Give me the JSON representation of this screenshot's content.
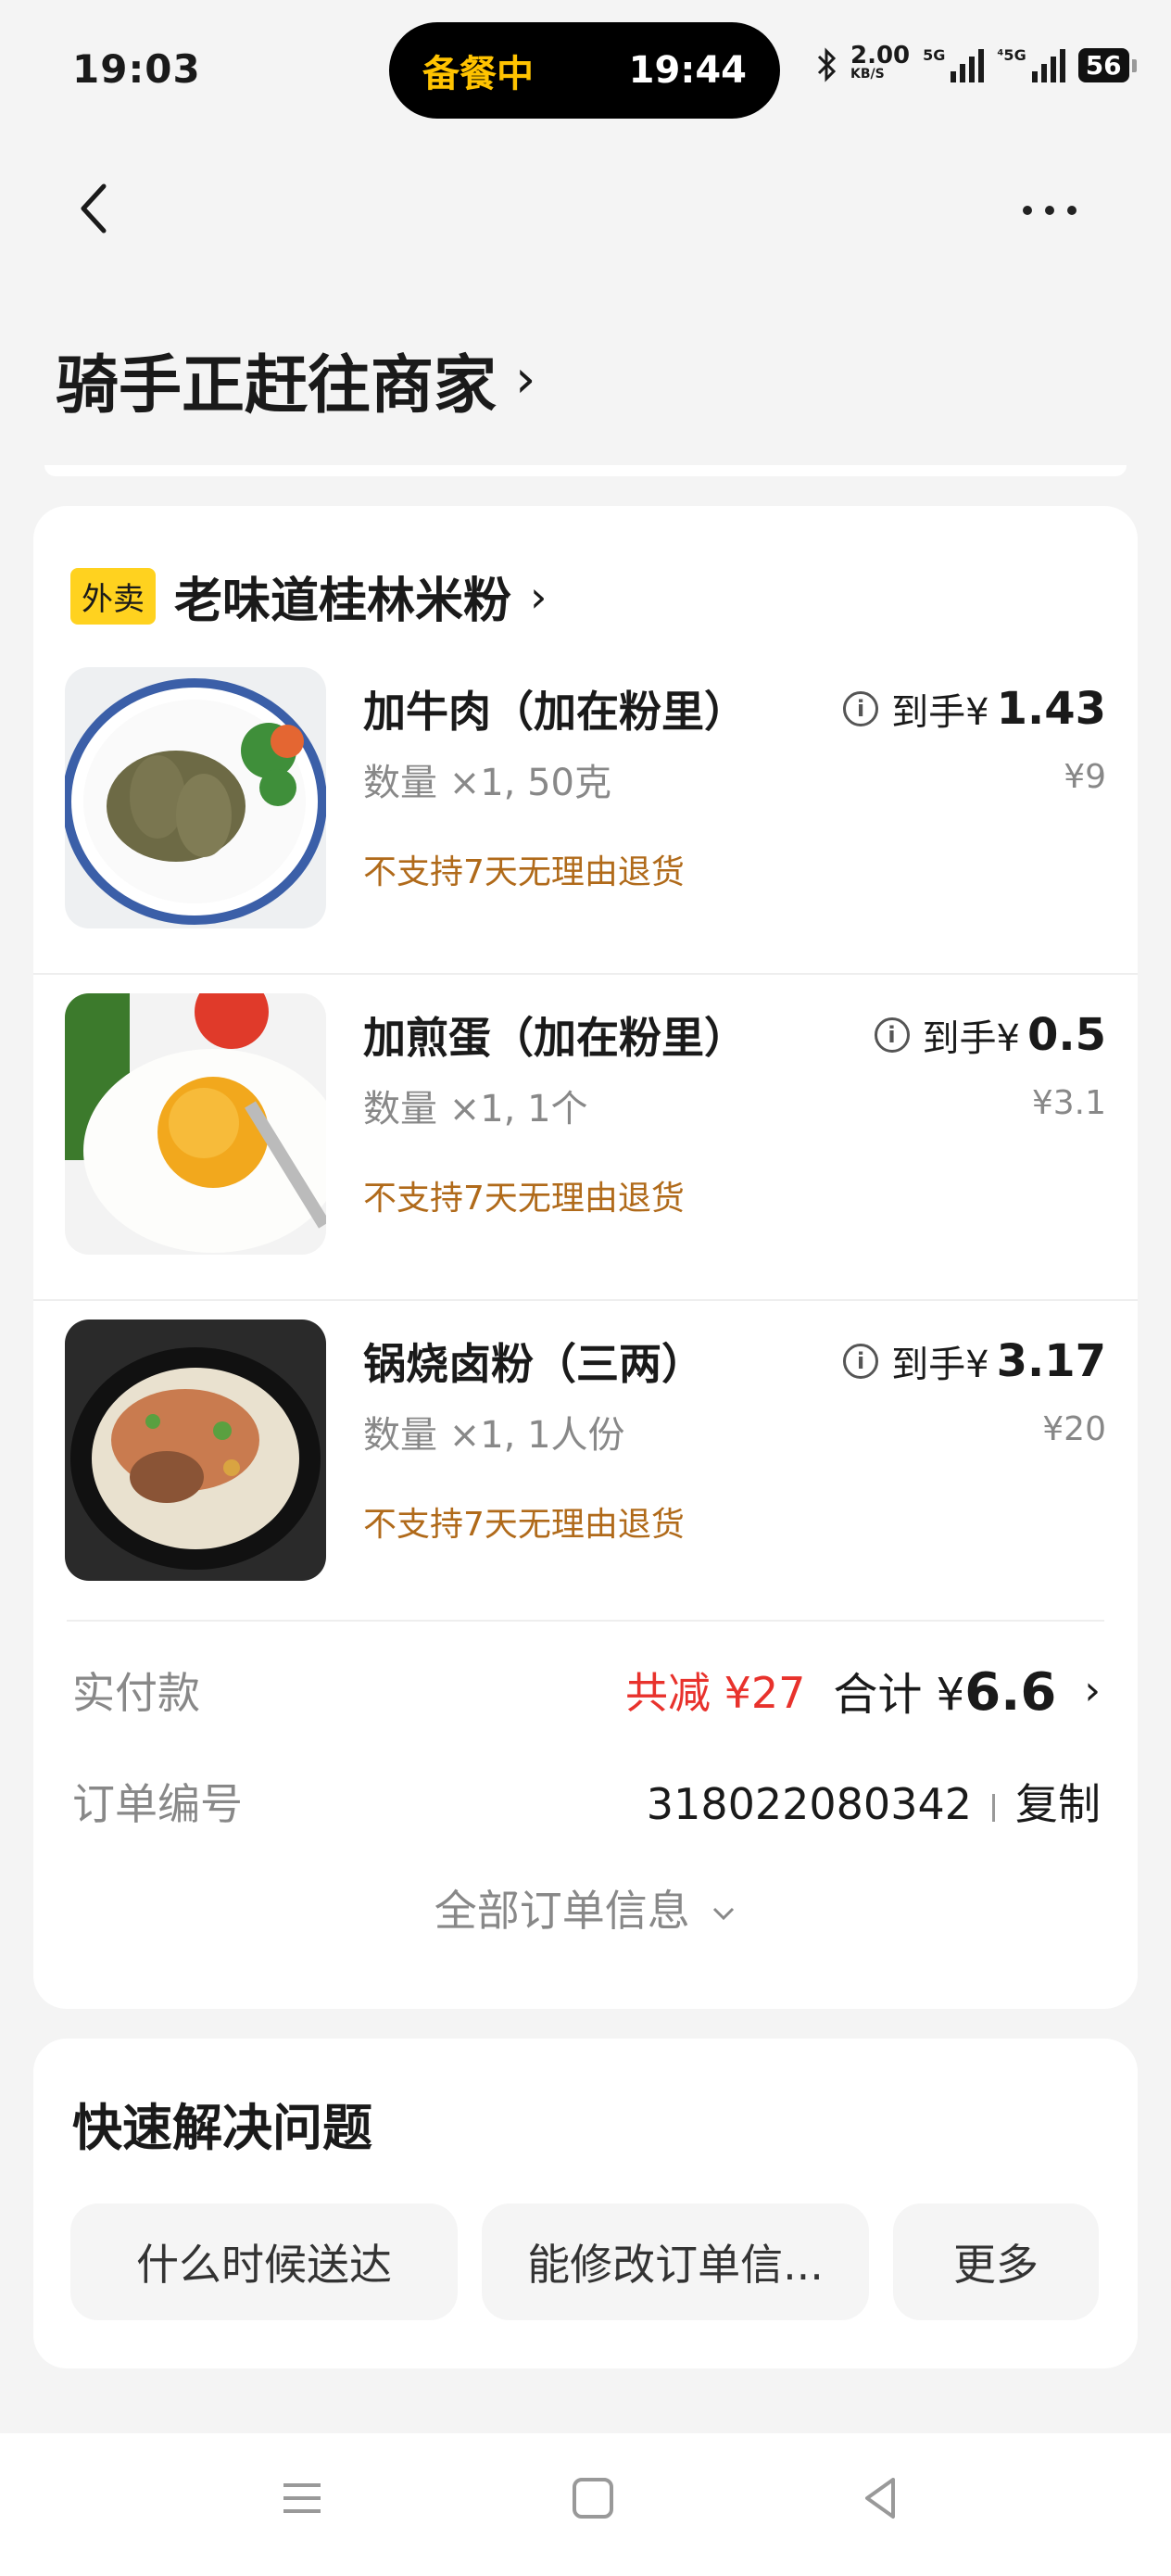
{
  "status_bar": {
    "time": "19:03",
    "pill_label": "备餐中",
    "pill_time": "19:44",
    "net_speed": "2.00",
    "net_unit": "KB/S",
    "sig1_label": "5G",
    "sig2_label": "⁴5G",
    "battery": "56"
  },
  "header": {
    "title": "骑手正赶往商家"
  },
  "shop": {
    "badge": "外卖",
    "name": "老味道桂林米粉"
  },
  "items": [
    {
      "name": "加牛肉（加在粉里）",
      "qty": "数量 ×1, 50克",
      "note": "不支持7天无理由退货",
      "price_prefix": "到手¥",
      "price": "1.43",
      "orig": "¥9"
    },
    {
      "name": "加煎蛋（加在粉里）",
      "qty": "数量 ×1, 1个",
      "note": "不支持7天无理由退货",
      "price_prefix": "到手¥",
      "price": "0.5",
      "orig": "¥3.1"
    },
    {
      "name": "锅烧卤粉（三两）",
      "qty": "数量 ×1, 1人份",
      "note": "不支持7天无理由退货",
      "price_prefix": "到手¥",
      "price": "3.17",
      "orig": "¥20"
    }
  ],
  "payment": {
    "label": "实付款",
    "discount": "共减 ¥27",
    "total_label": "合计 ¥",
    "total": "6.6"
  },
  "order_no": {
    "label": "订单编号",
    "value": "318022080342",
    "copy": "复制"
  },
  "all_info": "全部订单信息",
  "quick": {
    "title": "快速解决问题",
    "chips": [
      "什么时候送达",
      "能修改订单信...",
      "更多"
    ]
  }
}
